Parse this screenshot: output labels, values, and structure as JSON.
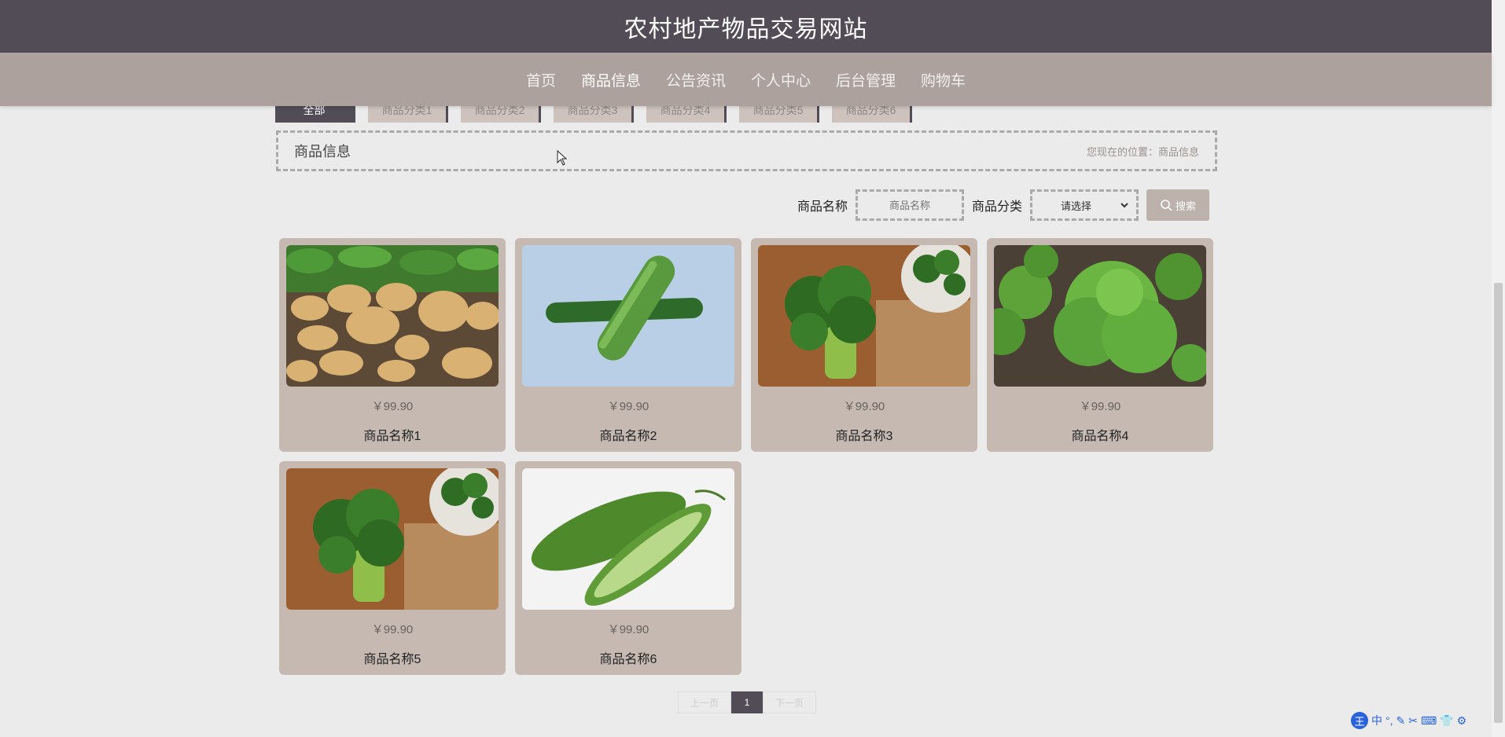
{
  "header": {
    "site_title": "农村地产物品交易网站"
  },
  "nav": {
    "items": [
      {
        "label": "首页"
      },
      {
        "label": "商品信息"
      },
      {
        "label": "公告资讯"
      },
      {
        "label": "个人中心"
      },
      {
        "label": "后台管理"
      },
      {
        "label": "购物车"
      }
    ],
    "active_index": 1
  },
  "category_tabs": [
    {
      "label": "全部"
    },
    {
      "label": "商品分类1"
    },
    {
      "label": "商品分类2"
    },
    {
      "label": "商品分类3"
    },
    {
      "label": "商品分类4"
    },
    {
      "label": "商品分类5"
    },
    {
      "label": "商品分类6"
    }
  ],
  "breadcrumb": {
    "title": "商品信息",
    "location": "您现在的位置：商品信息"
  },
  "search": {
    "name_label": "商品名称",
    "name_placeholder": "商品名称",
    "category_label": "商品分类",
    "category_selected": "请选择",
    "button_label": "搜索"
  },
  "products": [
    {
      "price": "￥99.90",
      "name": "商品名称1",
      "image": "potatoes"
    },
    {
      "price": "￥99.90",
      "name": "商品名称2",
      "image": "cucumbers"
    },
    {
      "price": "￥99.90",
      "name": "商品名称3",
      "image": "broccoli"
    },
    {
      "price": "￥99.90",
      "name": "商品名称4",
      "image": "lettuce"
    },
    {
      "price": "￥99.90",
      "name": "商品名称5",
      "image": "broccoli"
    },
    {
      "price": "￥99.90",
      "name": "商品名称6",
      "image": "bitter-melon"
    }
  ],
  "pagination": {
    "prev": "上一页",
    "current": "1",
    "next": "下一页"
  },
  "ime": {
    "brand": "王",
    "mode": "中"
  },
  "colors": {
    "header_bg": "#524c57",
    "nav_bg": "#aca19c",
    "card_bg": "#c5b9b2",
    "page_bg": "#ebebeb"
  }
}
